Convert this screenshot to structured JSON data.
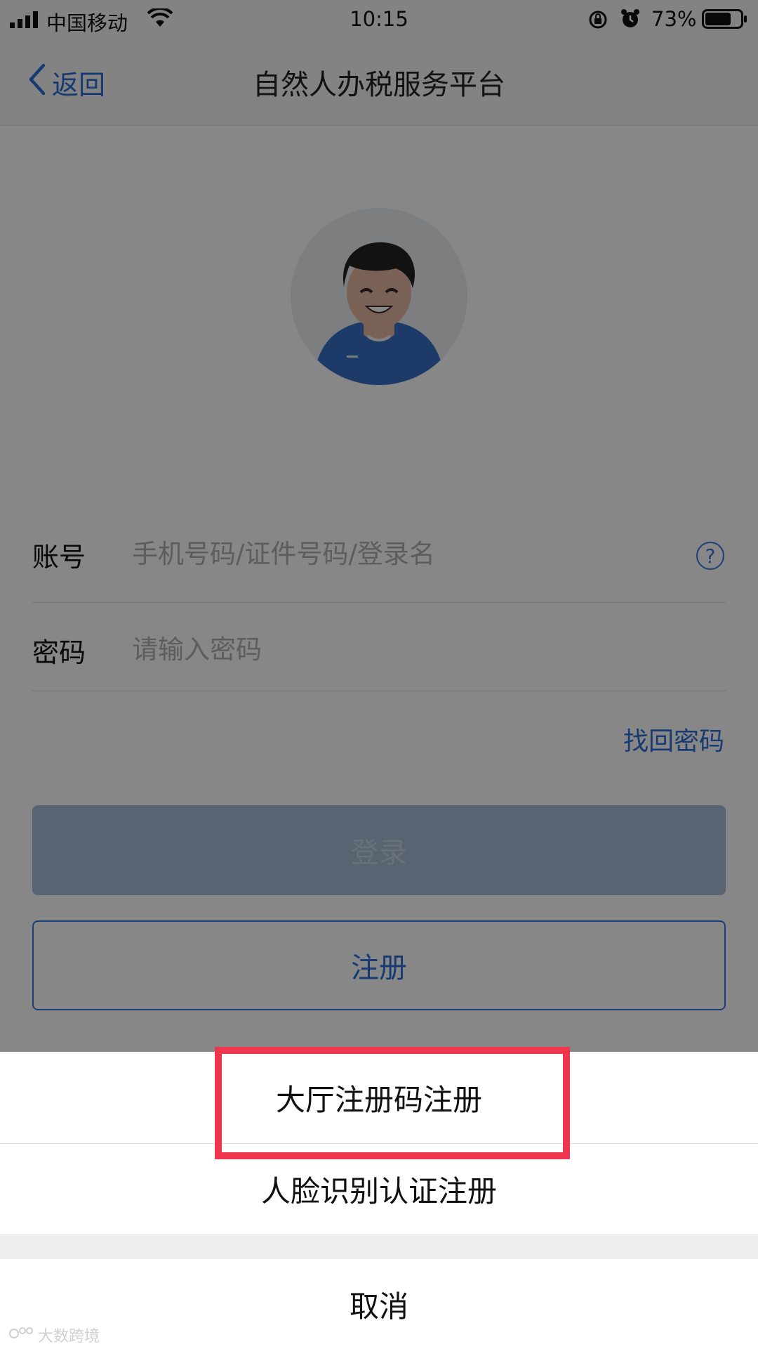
{
  "status_bar": {
    "carrier": "中国移动",
    "time": "10:15",
    "battery": "73%",
    "battery_level": 0.73
  },
  "nav": {
    "back_label": "返回",
    "title": "自然人办税服务平台"
  },
  "form": {
    "account_label": "账号",
    "account_placeholder": "手机号码/证件号码/登录名",
    "password_label": "密码",
    "password_placeholder": "请输入密码",
    "forgot_password": "找回密码"
  },
  "buttons": {
    "login": "登录",
    "register": "注册"
  },
  "action_sheet": {
    "options": [
      "大厅注册码注册",
      "人脸识别认证注册"
    ],
    "cancel": "取消"
  },
  "watermark": "大数跨境",
  "colors": {
    "accent": "#2f6fd9",
    "highlight": "#f0354e"
  }
}
